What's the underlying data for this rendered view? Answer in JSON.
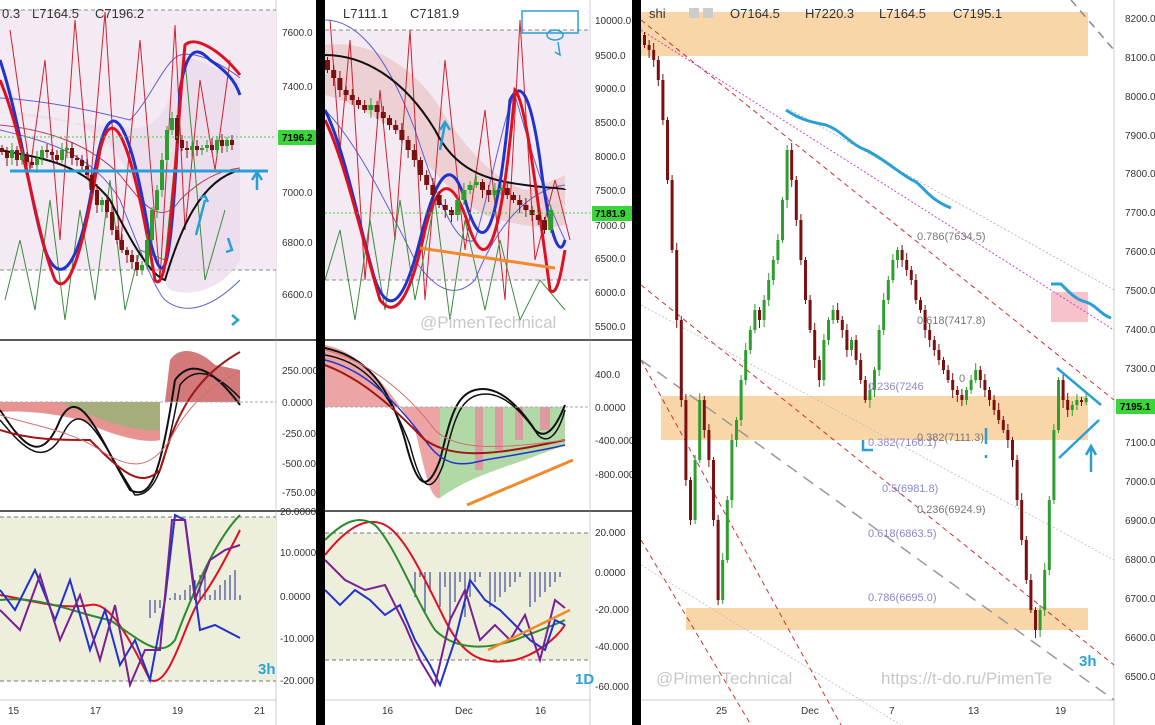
{
  "left_panel": {
    "header": {
      "ohlc_prefix": "0.3",
      "low": "L7164.5",
      "close": "C7196.2"
    },
    "price_axis": [
      "7600.0",
      "7400.0",
      "7196.2",
      "7000.0",
      "6800.0",
      "6600.0"
    ],
    "price_badge": "7196.2",
    "macd_axis": [
      "250.000",
      "0.0000",
      "-250.000",
      "-500.000",
      "-750.000"
    ],
    "osc_axis": [
      "20.0000",
      "10.0000",
      "0.0000",
      "-10.000",
      "-20.000"
    ],
    "x_axis": [
      "15",
      "17",
      "19",
      "21"
    ],
    "timeframe": "3h"
  },
  "middle_panel": {
    "header": {
      "low": "L7111.1",
      "close": "C7181.9"
    },
    "price_axis": [
      "10000.0",
      "9500.0",
      "9000.0",
      "8500.0",
      "8000.0",
      "7500.0",
      "7000.0",
      "6500.0",
      "6000.0",
      "5500.0"
    ],
    "price_badge": "7181.9",
    "macd_axis": [
      "400.0",
      "0.0000",
      "-400.000",
      "-800.000"
    ],
    "osc_axis": [
      "20.000",
      "0.0000",
      "-20.000",
      "-40.000",
      "-60.000"
    ],
    "x_axis": [
      "16",
      "Dec",
      "16"
    ],
    "watermark": "@PimenTechnical",
    "timeframe": "1D"
  },
  "right_panel": {
    "header": {
      "symbol": "shi",
      "open": "O7164.5",
      "high": "H7220.3",
      "low": "L7164.5",
      "close": "C7195.1"
    },
    "price_axis": [
      "8200.0",
      "8100.0",
      "8000.0",
      "7900.0",
      "7800.0",
      "7700.0",
      "7600.0",
      "7500.0",
      "7400.0",
      "7300.0",
      "7195.1",
      "7100.0",
      "7000.0",
      "6900.0",
      "6800.0",
      "6700.0",
      "6600.0",
      "6500.0"
    ],
    "price_badge": "7195.1",
    "x_axis": [
      "25",
      "Dec",
      "7",
      "13",
      "19"
    ],
    "fib_labels": [
      "0.786(7634.5)",
      "0.618(7417.8)",
      "0.236(7246",
      "0",
      "0.382(7160.1)",
      "0.382(7111.3)",
      "0.5(6981.8)",
      "0.236(6924.9)",
      "0.618(6863.5)",
      "0.786(6695.0)"
    ],
    "watermark_left": "@PimenTechnical",
    "watermark_right": "https://t-do.ru/PimenTe",
    "timeframe": "3h"
  },
  "colors": {
    "bull_candle": "#2e9e2e",
    "bear_candle": "#7a1010",
    "zone_orange": "#f5c88a",
    "zone_pink": "#f6b3bd",
    "price_badge": "#39d639",
    "trendline_blue": "#2a9fd6",
    "trendline_orange": "#f08a2a"
  }
}
